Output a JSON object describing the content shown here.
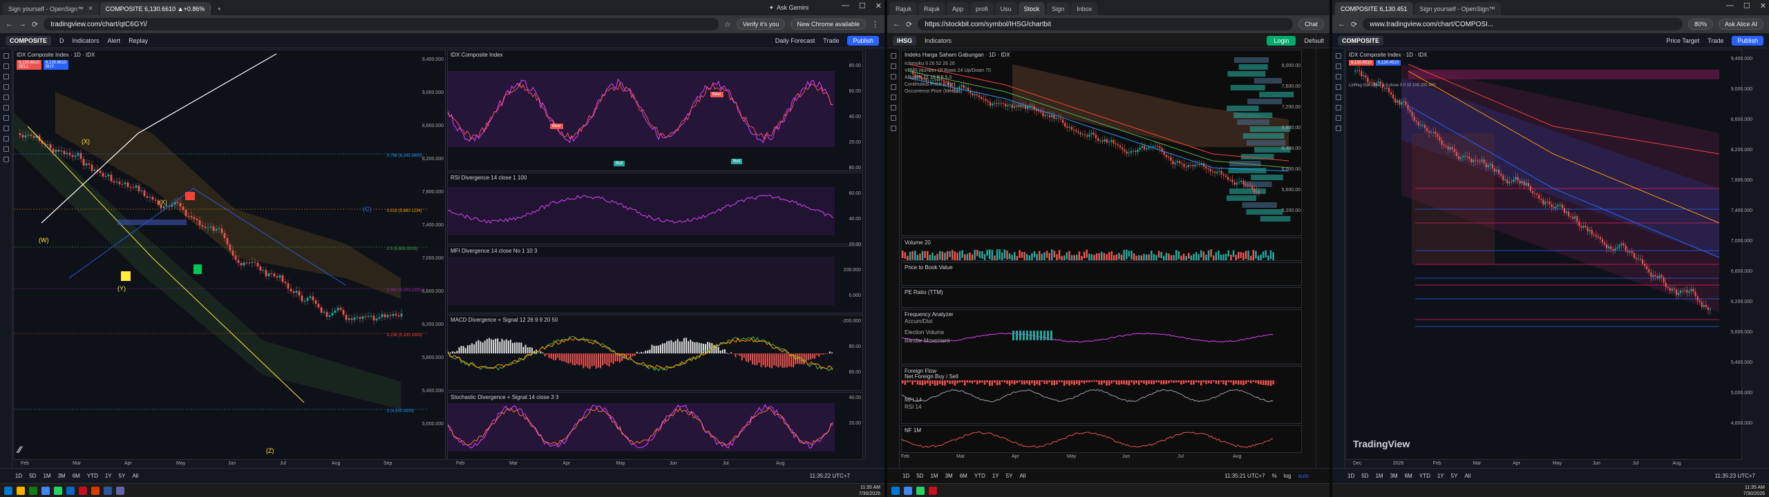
{
  "screen1": {
    "tabs": [
      {
        "label": "Sign yourself - OpenSign™",
        "active": false
      },
      {
        "label": "COMPOSITE 6,130.6610 ▲+0.86%",
        "active": true
      }
    ],
    "new_tab": "+",
    "url": "tradingview.com/chart/qtC6GYi/",
    "ask_gemini": "Ask Gemini",
    "verify": "Verify it's you",
    "new_chrome": "New Chrome available",
    "symbol": "COMPOSITE",
    "interval": "D",
    "indicators_btn": "Indicators",
    "alert_btn": "Alert",
    "replay_btn": "Replay",
    "daily_forecast": "Daily Forecast",
    "trade_btn": "Trade",
    "publish_btn": "Publish",
    "chart_title": "IDX Composite Index · 1D · IDX",
    "sell_price": "6,130.6610",
    "buy_price": "6,130.6610",
    "sell_label": "SELL",
    "buy_label": "BUY",
    "rsi_title": "IDX Composite Index",
    "rsi_div_label": "RSI Divergence 14 close 1 100",
    "mfi_label": "MFI Divergence 14 close No 1 10 3",
    "macd_label": "MACD Divergence + Signal 12 26 9 9 20 50",
    "stoch_label": "Stochastic Divergence + Signal 14 close 3 3",
    "waves": [
      "(X)",
      "(X)",
      "(W)",
      "(Y)",
      "(Z)",
      "(C)"
    ],
    "fib_labels": [
      "0.786 (6,245.5600)",
      "0.618 (5,880.1234)",
      "0.5 (5,600.0000)",
      "0.382 (5,300.1200)",
      "0.236 (5,100.1000)",
      "0 (4,500.0000)"
    ],
    "bull_label": "Bull",
    "bear_label": "Bear",
    "main_axis": [
      "9,400.000",
      "9,000.000",
      "8,600.000",
      "8,200.000",
      "7,800.000",
      "7,400.000",
      "7,000.000",
      "6,600.000",
      "6,200.000",
      "5,800.000",
      "5,400.000",
      "5,000.000"
    ],
    "ind_axis": [
      "80.00",
      "60.00",
      "40.00",
      "20.00"
    ],
    "macd_axis": [
      "200.000",
      "0.000",
      "-200.000"
    ],
    "months_left": [
      "Feb",
      "Mar",
      "Apr",
      "May",
      "Jun",
      "Jul",
      "Aug",
      "Sep"
    ],
    "months_right": [
      "Feb",
      "Mar",
      "Apr",
      "May",
      "Jun",
      "Jul",
      "Aug"
    ],
    "periods": [
      "1D",
      "5D",
      "1M",
      "3M",
      "6M",
      "YTD",
      "1Y",
      "5Y",
      "All"
    ],
    "time": "11:35:22 UTC+7",
    "tv_logo": "TradingView"
  },
  "screen2": {
    "tabs": [
      {
        "label": "Rajuk",
        "active": false
      },
      {
        "label": "Rajuk",
        "active": false
      },
      {
        "label": "App",
        "active": false
      },
      {
        "label": "profi",
        "active": false
      },
      {
        "label": "Usu",
        "active": false
      },
      {
        "label": "Stock",
        "active": true
      },
      {
        "label": "Sign",
        "active": false
      },
      {
        "label": "Inbox",
        "active": false
      }
    ],
    "url": "https://stockbit.com/symbol/IHSG/chartbit",
    "chat_btn": "Chat",
    "symbol": "IHSG",
    "indicators_btn": "Indicators",
    "login_btn": "Login",
    "default_btn": "Default",
    "chart_title": "Indeks Harga Saham Gabungan · 1D · IDX",
    "ind_lines": [
      "Ichimoku 9 26 52 26 26",
      "VPVR Number Of Rows 24 Up/Down 70",
      "Alligator 21 13 8 8 5 3",
      "Continuous Price (Line)",
      "Occurrence Price (Median)"
    ],
    "volume_label": "Volume 20",
    "pbv_label": "Price to Book Value",
    "pe_label": "PE Ratio (TTM)",
    "freq_label": "Frequency Analyzer",
    "freq_sub": "Accum/Dist",
    "vol_sub": "Election Volume",
    "bandar_label": "Bandar Movement",
    "foreign_label": "Foreign Flow",
    "netforeign_label": "Net Foreign Buy / Sell",
    "mfi_label": "MFI 14",
    "rsi_label": "RSI 14",
    "nf_label": "NF 1M",
    "year_label": "2026",
    "months": [
      "Feb",
      "Mar",
      "Apr",
      "May",
      "Jun",
      "Jul",
      "Aug"
    ],
    "periods": [
      "1D",
      "5D",
      "1M",
      "3M",
      "6M",
      "YTD",
      "1Y",
      "5Y",
      "All"
    ],
    "time": "11:35:21 UTC+7",
    "pct": "%",
    "log": "log",
    "auto": "auto",
    "axis": [
      "8,000.00",
      "7,600.00",
      "7,200.00",
      "6,800.00",
      "6,400.00",
      "6,000.00",
      "5,600.00",
      "5,200.00"
    ]
  },
  "screen3": {
    "tabs": [
      {
        "label": "COMPOSITE 6,130.451",
        "active": true
      },
      {
        "label": "Sign yourself - OpenSign™",
        "active": false
      }
    ],
    "url": "www.tradingview.com/chart/COMPOSI...",
    "zoom": "80%",
    "ask_alice": "Ask Alice AI",
    "symbol": "COMPOSITE",
    "price_target": "Price Target",
    "trade_btn": "Trade",
    "publish_btn": "Publish",
    "chart_title": "IDX Composite Index · 1D · IDX",
    "linreg_label": "LinReg IDX close 3 3 close 0 0 10 100 200 400",
    "sell_price": "6,130.4510",
    "buy_price": "6,130.4510",
    "tv_logo": "TradingView",
    "months": [
      "Dec",
      "2026",
      "Feb",
      "Mar",
      "Apr",
      "May",
      "Jun",
      "Jul",
      "Aug"
    ],
    "periods": [
      "1D",
      "5D",
      "1M",
      "3M",
      "6M",
      "YTD",
      "1Y",
      "5Y",
      "All"
    ],
    "time": "11:35:23 UTC+7",
    "axis": [
      "9,400.000",
      "9,000.000",
      "8,600.000",
      "8,200.000",
      "7,800.000",
      "7,400.000",
      "7,000.000",
      "6,600.000",
      "6,200.000",
      "5,800.000",
      "5,400.000",
      "5,000.000",
      "4,600.000"
    ],
    "clock_time": "11:35 AM",
    "clock_date": "7/30/2026"
  },
  "taskbar": {
    "clock_time": "11:35 AM",
    "clock_date": "7/30/2026"
  },
  "colors": {
    "up": "#26a69a",
    "down": "#ef5350",
    "accent": "#2962ff",
    "purple": "#9c27b0",
    "bg": "#131722"
  }
}
